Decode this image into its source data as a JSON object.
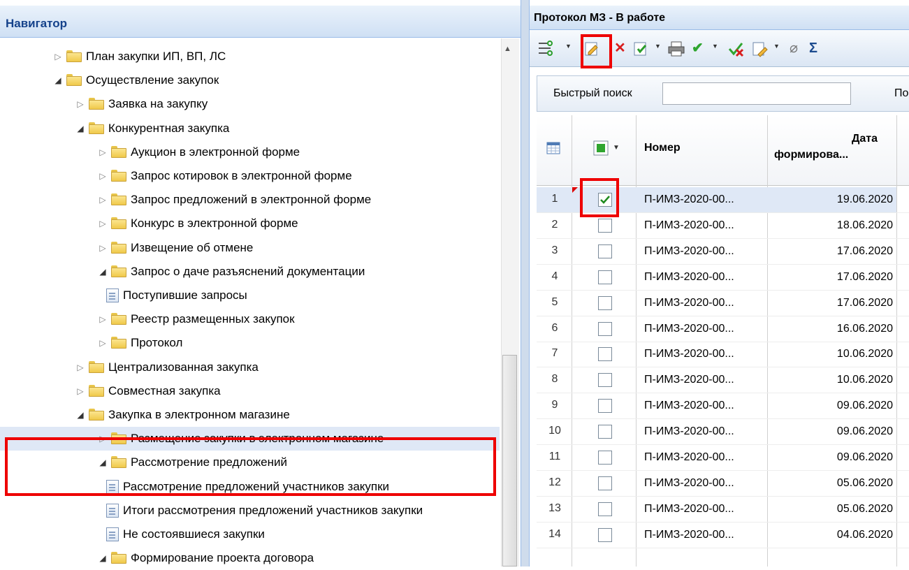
{
  "navigator": {
    "title": "Навигатор",
    "items": [
      {
        "label": "План закупки ИП, ВП, ЛС",
        "state": "collapsed",
        "type": "folder"
      },
      {
        "label": "Осуществление закупок",
        "state": "expanded",
        "type": "folder"
      },
      {
        "label": "Заявка на закупку",
        "state": "collapsed",
        "type": "folder"
      },
      {
        "label": "Конкурентная закупка",
        "state": "expanded",
        "type": "folder"
      },
      {
        "label": "Аукцион в электронной форме",
        "state": "collapsed",
        "type": "folder"
      },
      {
        "label": "Запрос котировок в электронной форме",
        "state": "collapsed",
        "type": "folder"
      },
      {
        "label": "Запрос предложений в электронной форме",
        "state": "collapsed",
        "type": "folder"
      },
      {
        "label": "Конкурс в электронной форме",
        "state": "collapsed",
        "type": "folder"
      },
      {
        "label": "Извещение об отмене",
        "state": "collapsed",
        "type": "folder"
      },
      {
        "label": "Запрос о даче разъяснений документации",
        "state": "expanded",
        "type": "folder"
      },
      {
        "label": "Поступившие запросы",
        "state": "leaf",
        "type": "document"
      },
      {
        "label": "Реестр размещенных закупок",
        "state": "collapsed",
        "type": "folder"
      },
      {
        "label": "Протокол",
        "state": "collapsed",
        "type": "folder"
      },
      {
        "label": "Централизованная закупка",
        "state": "collapsed",
        "type": "folder"
      },
      {
        "label": "Совместная закупка",
        "state": "collapsed",
        "type": "folder"
      },
      {
        "label": "Закупка в электронном магазине",
        "state": "expanded",
        "type": "folder"
      },
      {
        "label": "Размещение закупки в электронном магазине",
        "state": "collapsed",
        "type": "folder",
        "selected": true
      },
      {
        "label": "Рассмотрение предложений",
        "state": "expanded",
        "type": "folder"
      },
      {
        "label": "Рассмотрение предложений участников закупки",
        "state": "leaf",
        "type": "document"
      },
      {
        "label": "Итоги рассмотрения предложений участников закупки",
        "state": "leaf",
        "type": "document"
      },
      {
        "label": "Не состоявшиеся закупки",
        "state": "leaf",
        "type": "document"
      },
      {
        "label": "Формирование проекта договора",
        "state": "expanded",
        "type": "folder"
      }
    ]
  },
  "grid": {
    "title": "Протокол МЗ - В работе",
    "toolbar": {
      "icons": [
        "filter-settings-icon",
        "edit-icon",
        "delete-icon",
        "approve-document-icon",
        "print-icon",
        "check-icon",
        "cancel-check-icon",
        "document-action-icon",
        "attach-icon",
        "sum-icon"
      ]
    },
    "search": {
      "label": "Быстрый поиск",
      "value": "",
      "extra": "По"
    },
    "columns": {
      "number": "Номер",
      "date_line1": "Дата",
      "date_line2": "формирова..."
    },
    "rows": [
      {
        "n": "1",
        "checked": true,
        "number": "П-ИМЗ-2020-00...",
        "date": "19.06.2020"
      },
      {
        "n": "2",
        "checked": false,
        "number": "П-ИМЗ-2020-00...",
        "date": "18.06.2020"
      },
      {
        "n": "3",
        "checked": false,
        "number": "П-ИМЗ-2020-00...",
        "date": "17.06.2020"
      },
      {
        "n": "4",
        "checked": false,
        "number": "П-ИМЗ-2020-00...",
        "date": "17.06.2020"
      },
      {
        "n": "5",
        "checked": false,
        "number": "П-ИМЗ-2020-00...",
        "date": "17.06.2020"
      },
      {
        "n": "6",
        "checked": false,
        "number": "П-ИМЗ-2020-00...",
        "date": "16.06.2020"
      },
      {
        "n": "7",
        "checked": false,
        "number": "П-ИМЗ-2020-00...",
        "date": "10.06.2020"
      },
      {
        "n": "8",
        "checked": false,
        "number": "П-ИМЗ-2020-00...",
        "date": "10.06.2020"
      },
      {
        "n": "9",
        "checked": false,
        "number": "П-ИМЗ-2020-00...",
        "date": "09.06.2020"
      },
      {
        "n": "10",
        "checked": false,
        "number": "П-ИМЗ-2020-00...",
        "date": "09.06.2020"
      },
      {
        "n": "11",
        "checked": false,
        "number": "П-ИМЗ-2020-00...",
        "date": "09.06.2020"
      },
      {
        "n": "12",
        "checked": false,
        "number": "П-ИМЗ-2020-00...",
        "date": "05.06.2020"
      },
      {
        "n": "13",
        "checked": false,
        "number": "П-ИМЗ-2020-00...",
        "date": "05.06.2020"
      },
      {
        "n": "14",
        "checked": false,
        "number": "П-ИМЗ-2020-00...",
        "date": "04.06.2020"
      }
    ]
  },
  "colors": {
    "highlight": "#ee0000",
    "header_text": "#15428b",
    "selection": "#dfe8f6"
  }
}
